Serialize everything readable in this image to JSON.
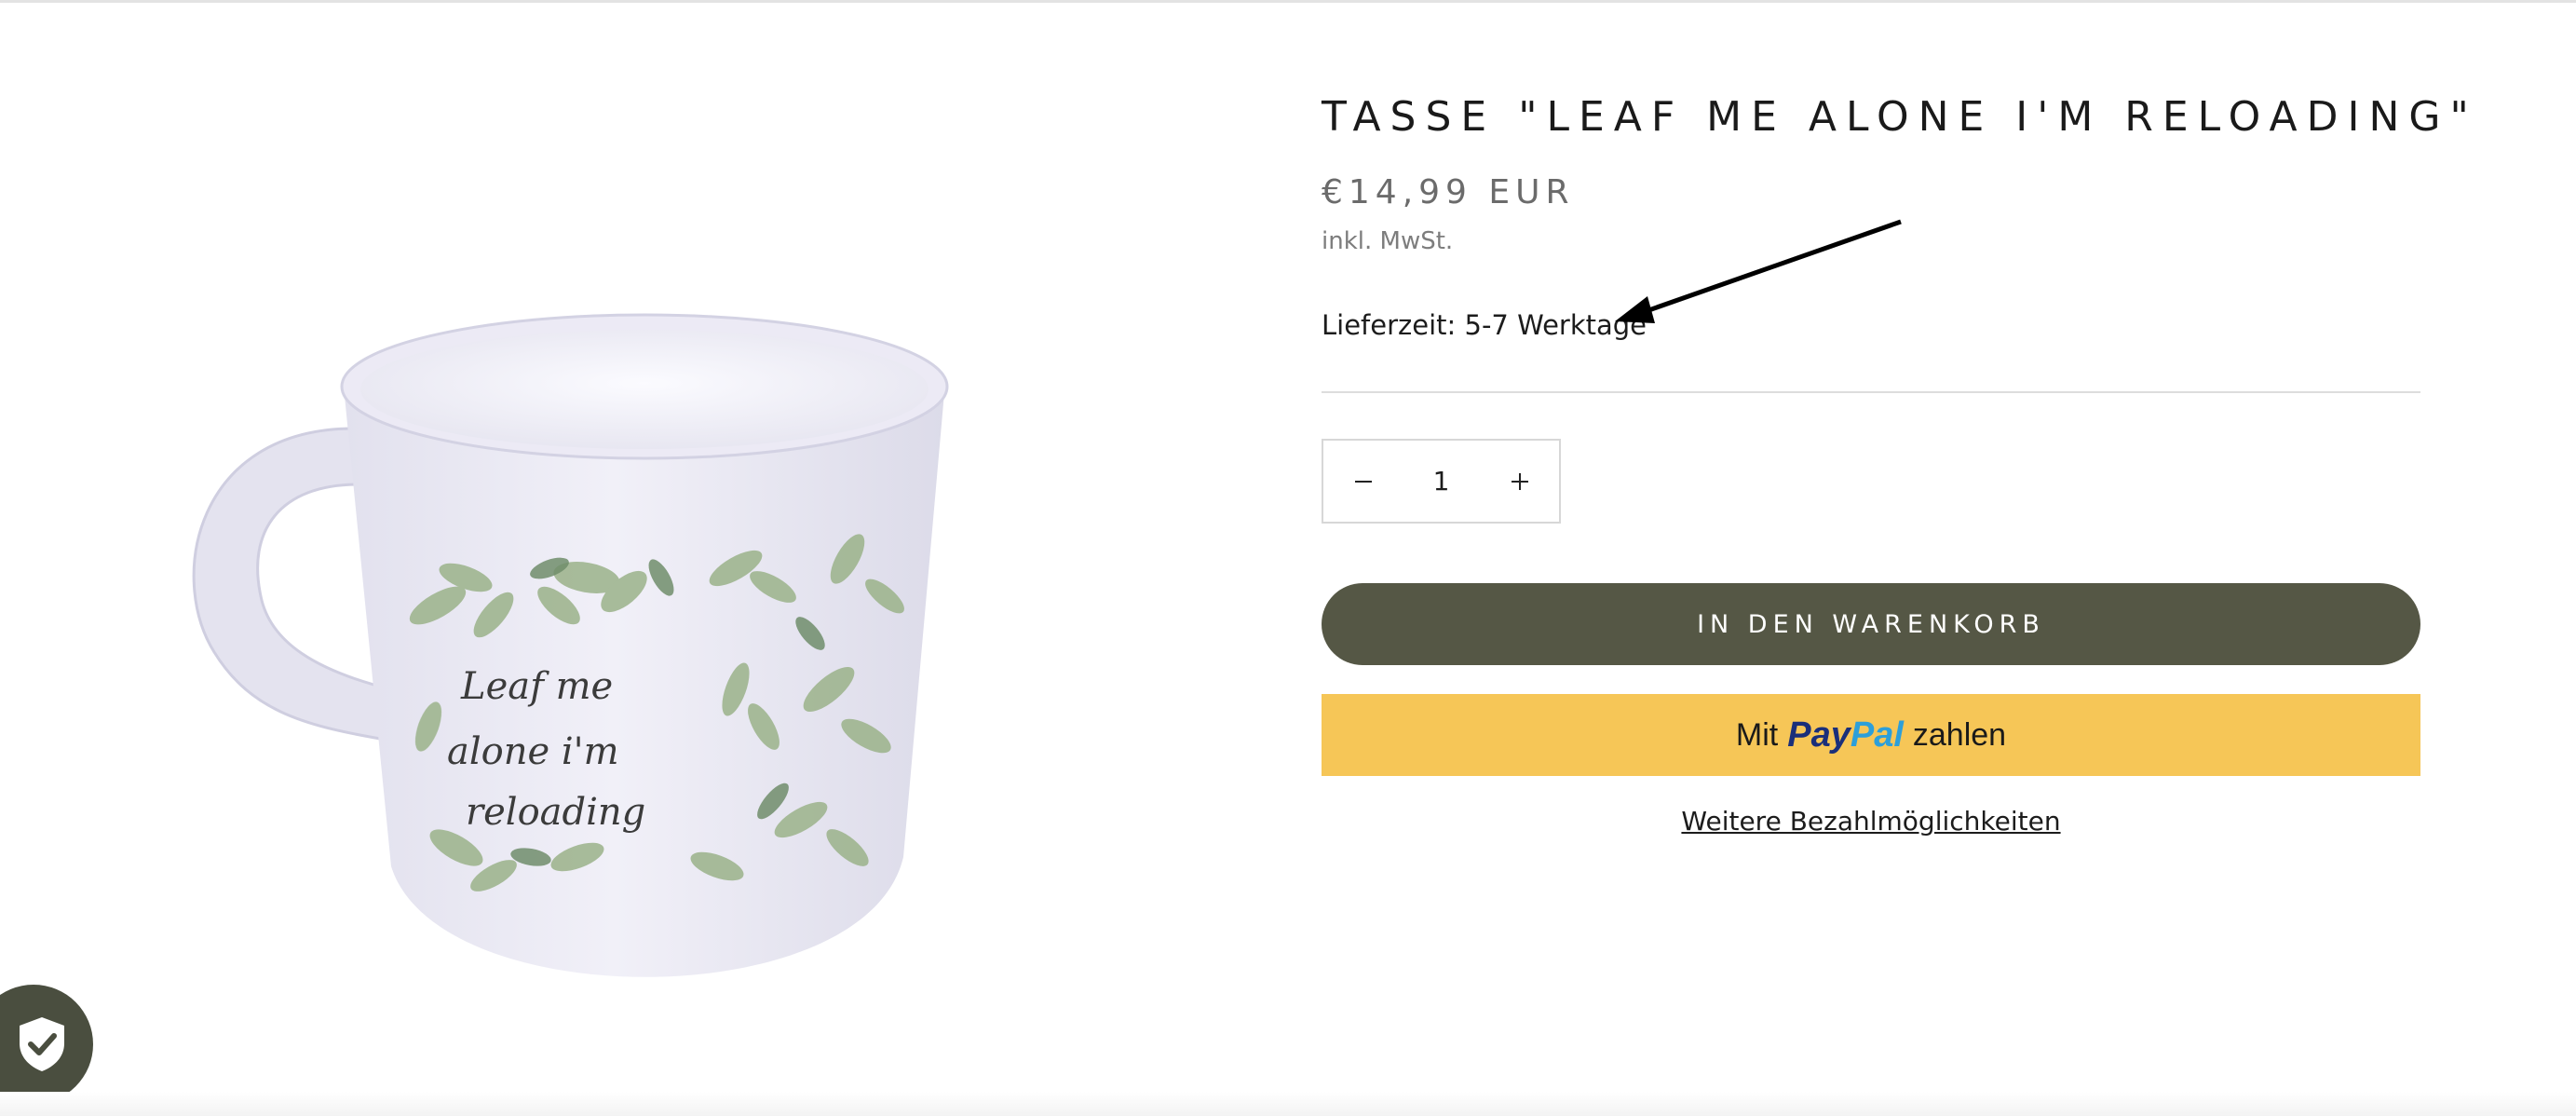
{
  "product": {
    "title": "TASSE \"LEAF ME ALONE I'M RELOADING\"",
    "price": "€14,99 EUR",
    "tax_note": "inkl. MwSt.",
    "delivery_time": "Lieferzeit: 5-7 Werktage",
    "image_text": [
      "Leaf me",
      "alone i'm",
      "reloading"
    ]
  },
  "quantity": {
    "value": "1"
  },
  "buttons": {
    "add_to_cart": "IN DEN WARENKORB",
    "paypal_prefix": "Mit",
    "paypal_logo_pay": "Pay",
    "paypal_logo_pal": "Pal",
    "paypal_suffix": "zahlen",
    "more_payment_options": "Weitere Bezahlmöglichkeiten"
  },
  "icons": {
    "quantity_decrease": "minus-icon",
    "quantity_increase": "plus-icon",
    "badge": "shield-check-icon",
    "annotation": "arrow-icon"
  },
  "colors": {
    "add_to_cart_bg": "#555745",
    "paypal_bg": "#f6c657",
    "paypal_blue_dark": "#1a2f7a",
    "paypal_blue_light": "#2d9fd9",
    "badge_bg": "#4a4e3f"
  }
}
